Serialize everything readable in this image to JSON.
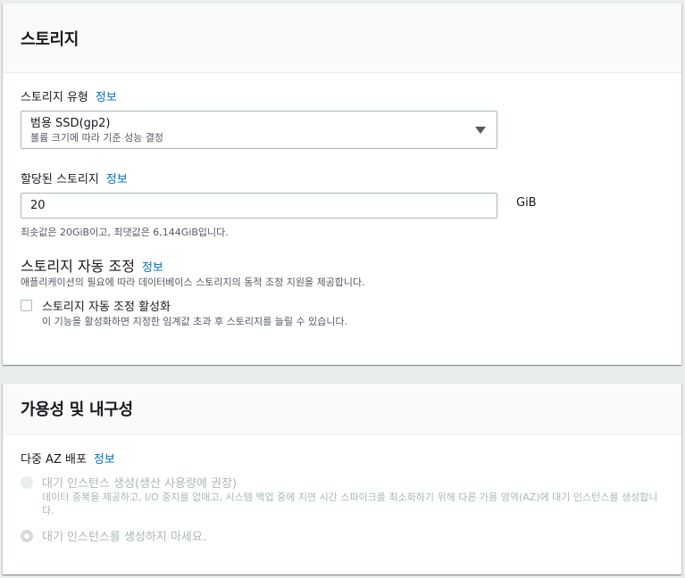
{
  "storage": {
    "title": "스토리지",
    "type_label": "스토리지 유형",
    "info": "정보",
    "type_value": "범용 SSD(gp2)",
    "type_sub": "볼륨 크기에 따라 기준 성능 결정",
    "allocated_label": "할당된 스토리지",
    "allocated_value": "20",
    "unit": "GiB",
    "allocated_hint": "최솟값은 20GiB이고, 최댓값은 6,144GiB입니다.",
    "autoscale_title": "스토리지 자동 조정",
    "autoscale_desc": "애플리케이션의 필요에 따라 데이터베이스 스토리지의 동적 조정 지원을 제공합니다.",
    "autoscale_checkbox_label": "스토리지 자동 조정 활성화",
    "autoscale_checkbox_desc": "이 기능을 활성화하면 지정한 임계값 초과 후 스토리지를 늘릴 수 있습니다.",
    "autoscale_checked": false
  },
  "availability": {
    "title": "가용성 및 내구성",
    "multi_az_label": "다중 AZ 배포",
    "info": "정보",
    "option1_label": "대기 인스턴스 생성(생산 사용량에 권장)",
    "option1_desc": "데이터 중복을 제공하고, I/O 중지를 없애고, 시스템 백업 중에 지연 시간 스파이크를 최소화하기 위해 다른 가용 영역(AZ)에 대기 인스턴스를 생성합니다.",
    "option2_label": "대기 인스턴스를 생성하지 마세요.",
    "selected_option": 2
  },
  "colors": {
    "link": "#0073bb",
    "border": "#aab7b8",
    "disabled_text": "#aab7b8"
  }
}
